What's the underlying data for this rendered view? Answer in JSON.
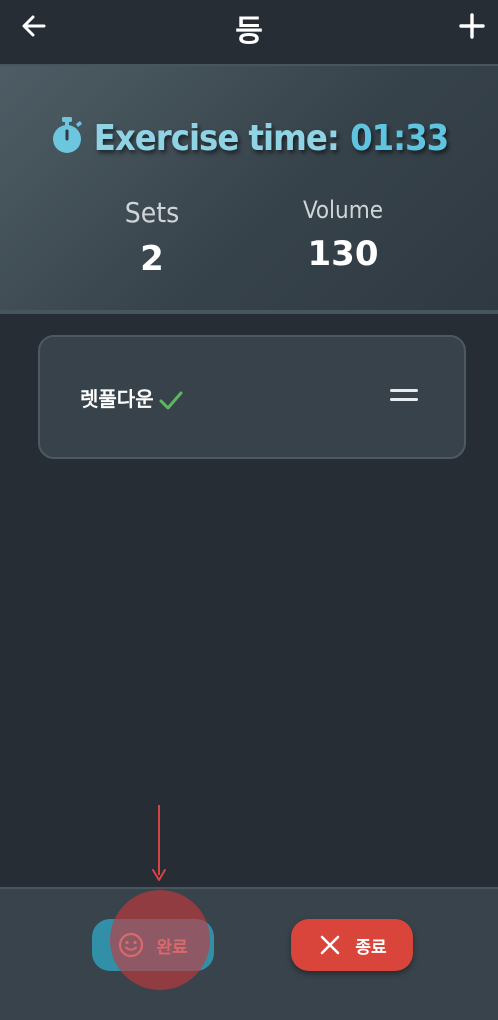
{
  "header": {
    "title": "등",
    "back_icon": "arrow-left-icon",
    "add_icon": "plus-icon"
  },
  "stats": {
    "timer_label": "Exercise time:",
    "timer_value": "01:33",
    "timer_icon": "stopwatch-icon",
    "sets_label": "Sets",
    "sets_value": "2",
    "volume_label": "Volume",
    "volume_value": "130"
  },
  "exercises": [
    {
      "name": "렛풀다운",
      "completed": true,
      "status_icon": "check-icon",
      "handle_icon": "drag-handle-icon"
    }
  ],
  "actions": {
    "done_label": "완료",
    "done_icon": "smiley-icon",
    "quit_label": "종료",
    "quit_icon": "close-icon"
  },
  "colors": {
    "background": "#272d35",
    "accent": "#5ec4e0",
    "done_button": "#318fa8",
    "quit_button": "#d9453b",
    "check": "#5cb85c",
    "tap_indicator": "#c8383c"
  }
}
